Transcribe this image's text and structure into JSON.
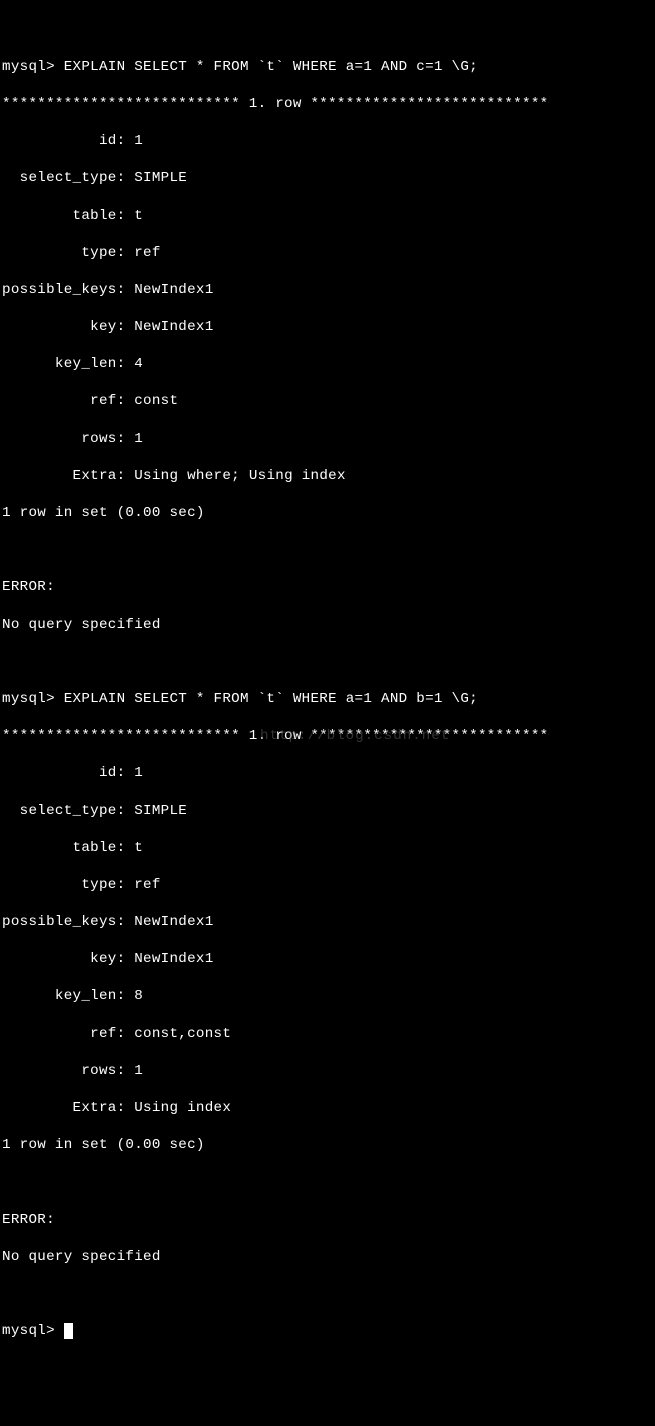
{
  "block1": {
    "prompt": "mysql> ",
    "command": "EXPLAIN SELECT * FROM `t` WHERE a=1 AND c=1 \\G;",
    "separator": "*************************** 1. row ***************************",
    "rows": [
      {
        "label": "           id",
        "value": "1"
      },
      {
        "label": "  select_type",
        "value": "SIMPLE"
      },
      {
        "label": "        table",
        "value": "t"
      },
      {
        "label": "         type",
        "value": "ref"
      },
      {
        "label": "possible_keys",
        "value": "NewIndex1"
      },
      {
        "label": "          key",
        "value": "NewIndex1"
      },
      {
        "label": "      key_len",
        "value": "4"
      },
      {
        "label": "          ref",
        "value": "const"
      },
      {
        "label": "         rows",
        "value": "1"
      },
      {
        "label": "        Extra",
        "value": "Using where; Using index"
      }
    ],
    "footer": "1 row in set (0.00 sec)",
    "error_label": "ERROR:",
    "error_msg": "No query specified"
  },
  "block2": {
    "prompt": "mysql> ",
    "command": "EXPLAIN SELECT * FROM `t` WHERE a=1 AND b=1 \\G;",
    "separator": "*************************** 1. row ***************************",
    "watermark": "http://blog.csdn.net",
    "rows": [
      {
        "label": "           id",
        "value": "1"
      },
      {
        "label": "  select_type",
        "value": "SIMPLE"
      },
      {
        "label": "        table",
        "value": "t"
      },
      {
        "label": "         type",
        "value": "ref"
      },
      {
        "label": "possible_keys",
        "value": "NewIndex1"
      },
      {
        "label": "          key",
        "value": "NewIndex1"
      },
      {
        "label": "      key_len",
        "value": "8"
      },
      {
        "label": "          ref",
        "value": "const,const"
      },
      {
        "label": "         rows",
        "value": "1"
      },
      {
        "label": "        Extra",
        "value": "Using index"
      }
    ],
    "footer": "1 row in set (0.00 sec)",
    "error_label": "ERROR:",
    "error_msg": "No query specified"
  },
  "final_prompt": "mysql> "
}
